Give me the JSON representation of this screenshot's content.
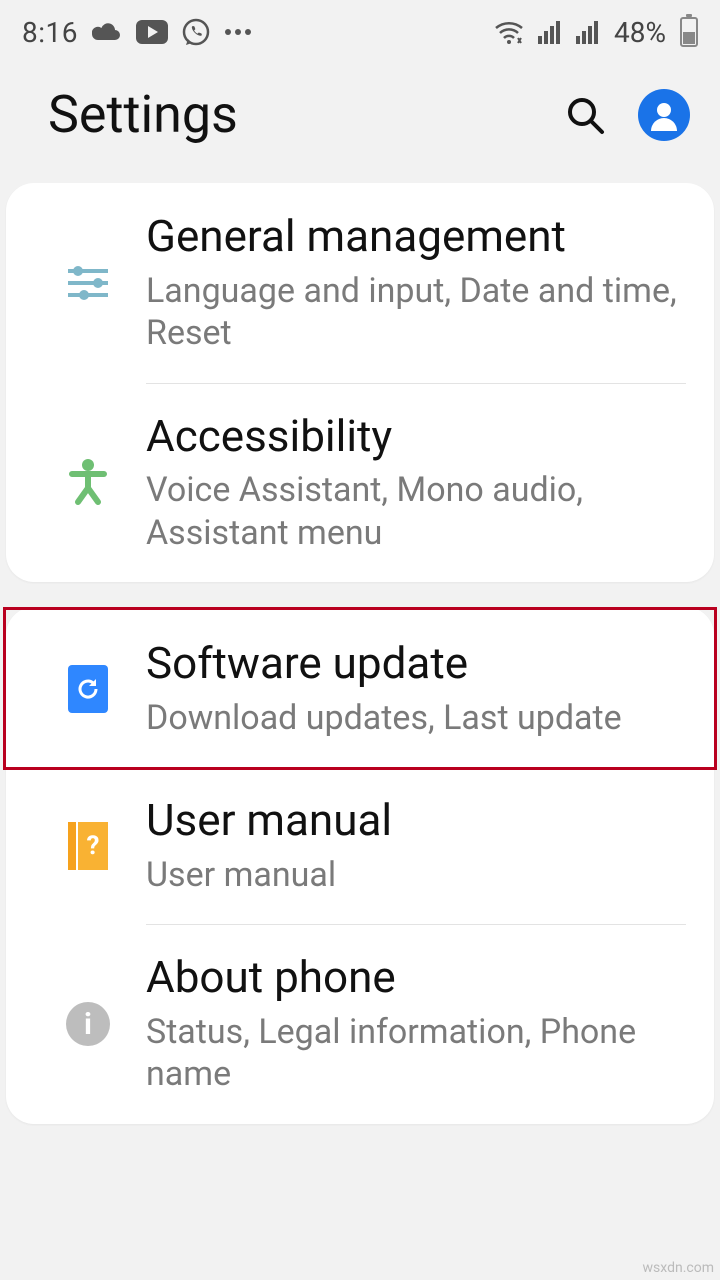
{
  "status": {
    "time": "8:16",
    "battery_pct": "48%"
  },
  "header": {
    "title": "Settings"
  },
  "group1": {
    "general_title": "General management",
    "general_sub": "Language and input, Date and time, Reset",
    "access_title": "Accessibility",
    "access_sub": "Voice Assistant, Mono audio, Assistant menu"
  },
  "group2": {
    "swupdate_title": "Software update",
    "swupdate_sub": "Download updates, Last update",
    "manual_title": "User manual",
    "manual_sub": "User manual",
    "about_title": "About phone",
    "about_sub": "Status, Legal information, Phone name"
  },
  "watermark": "wsxdn.com"
}
